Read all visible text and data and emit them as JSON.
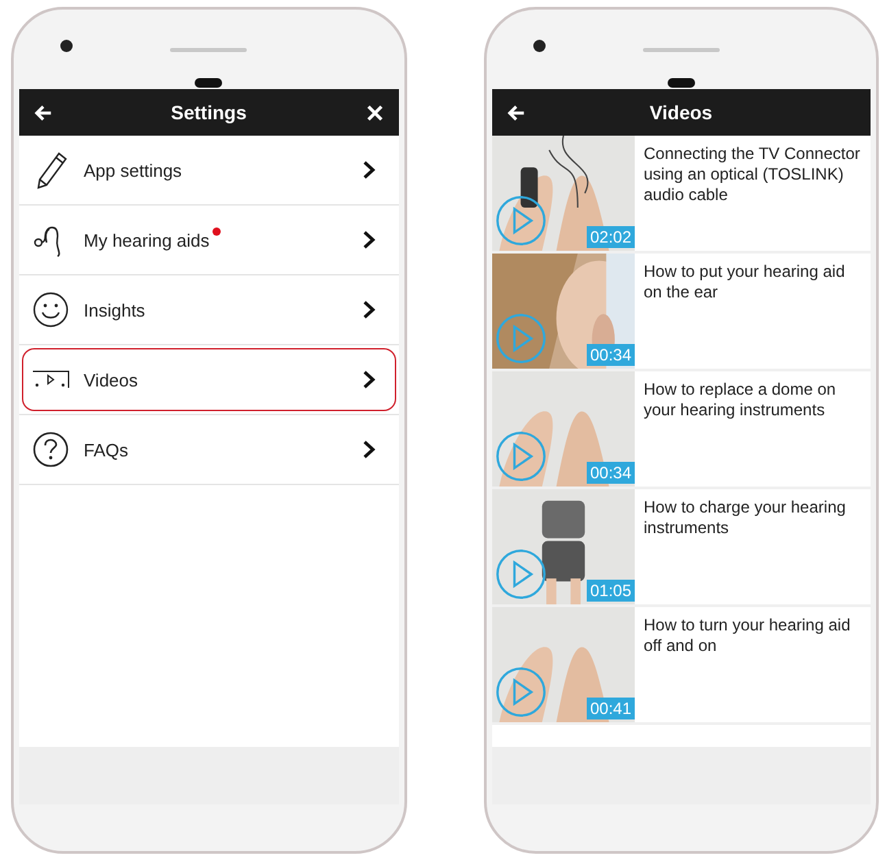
{
  "settings_screen": {
    "title": "Settings",
    "items": [
      {
        "label": "App settings",
        "kind": "pencil",
        "badge": false,
        "highlighted": false
      },
      {
        "label": "My hearing aids",
        "kind": "hearing-aid",
        "badge": true,
        "highlighted": false
      },
      {
        "label": "Insights",
        "kind": "smiley",
        "badge": false,
        "highlighted": false
      },
      {
        "label": "Videos",
        "kind": "video",
        "badge": false,
        "highlighted": true
      },
      {
        "label": "FAQs",
        "kind": "question",
        "badge": false,
        "highlighted": false
      }
    ]
  },
  "videos_screen": {
    "title": "Videos",
    "videos": [
      {
        "title": "Connecting the TV Connector using an optical (TOSLINK) audio cable",
        "duration": "02:02"
      },
      {
        "title": "How to put your hearing aid on the ear",
        "duration": "00:34"
      },
      {
        "title": "How to replace a dome on your hearing instruments",
        "duration": "00:34"
      },
      {
        "title": "How to charge your hearing instruments",
        "duration": "01:05"
      },
      {
        "title": "How to turn your hearing aid off and on",
        "duration": "00:41"
      }
    ]
  }
}
